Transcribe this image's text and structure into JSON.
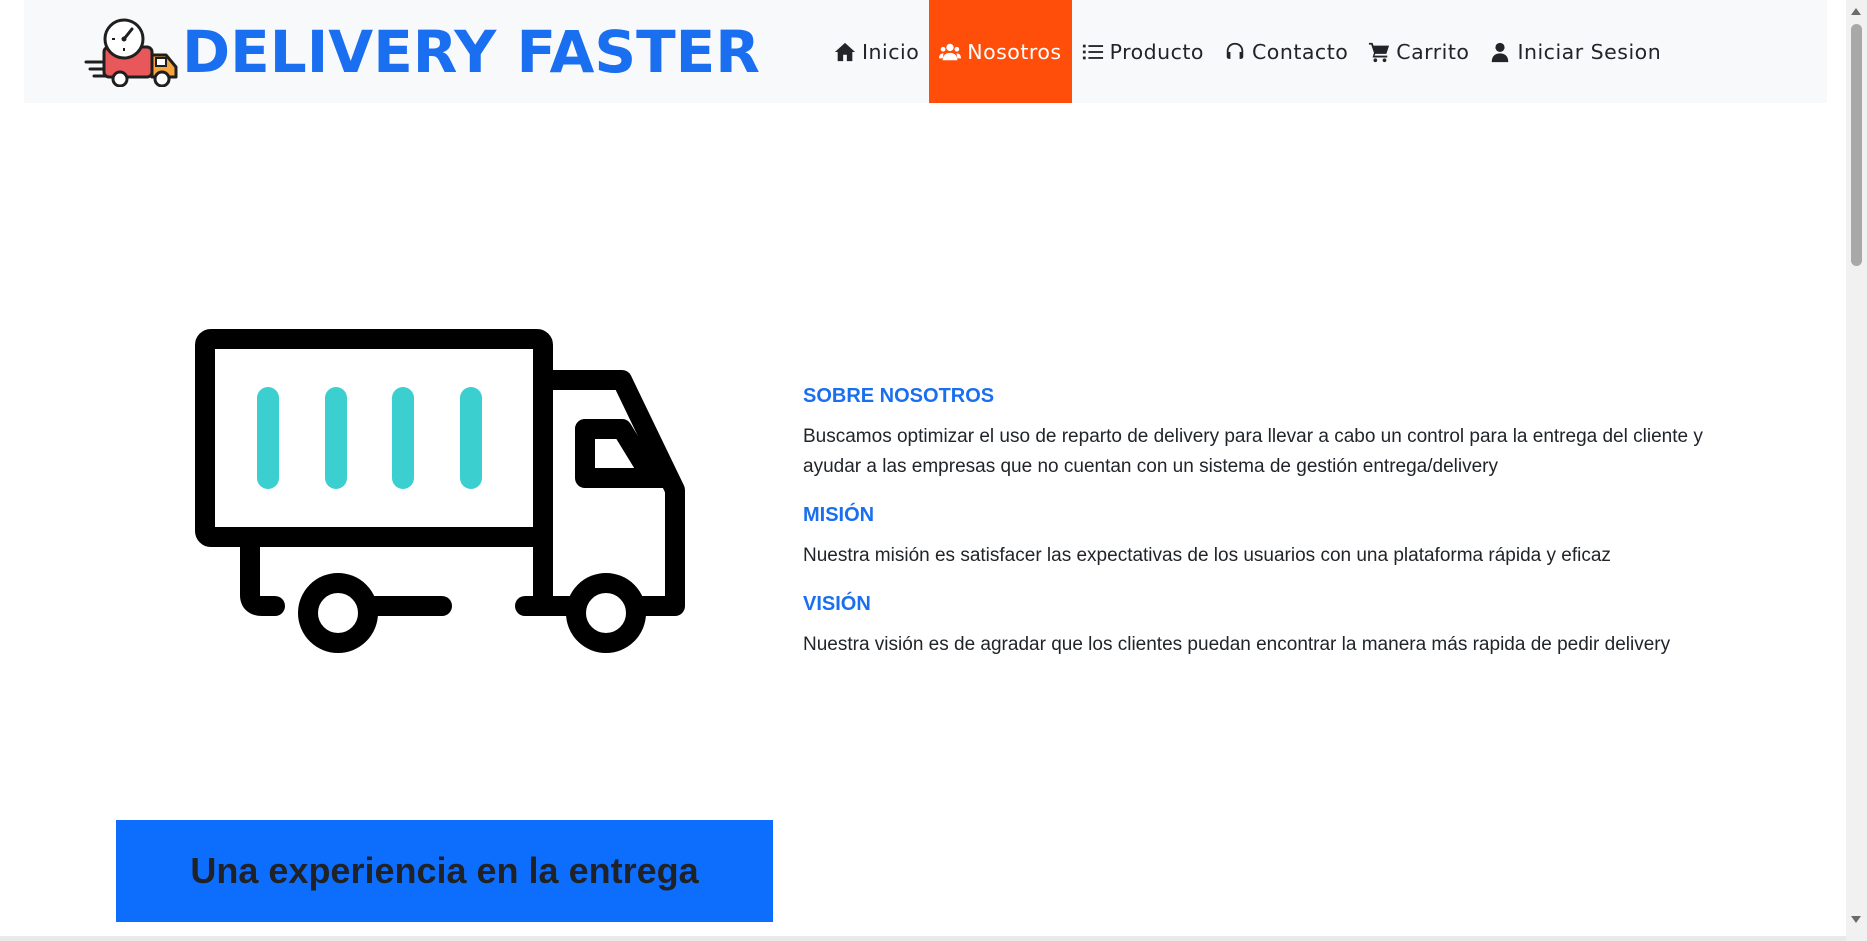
{
  "brand": {
    "name": "DELIVERY FASTER",
    "logo_icon": "delivery-truck-clock-icon"
  },
  "nav": {
    "items": [
      {
        "label": "Inicio",
        "icon": "home-icon",
        "active": false
      },
      {
        "label": "Nosotros",
        "icon": "users-icon",
        "active": true
      },
      {
        "label": "Producto",
        "icon": "list-icon",
        "active": false
      },
      {
        "label": "Contacto",
        "icon": "headset-icon",
        "active": false
      },
      {
        "label": "Carrito",
        "icon": "cart-icon",
        "active": false
      },
      {
        "label": "Iniciar Sesion",
        "icon": "user-icon",
        "active": false
      }
    ],
    "active_color": "#ff4d0a"
  },
  "about": {
    "sections": [
      {
        "title": "SOBRE NOSOTROS",
        "text": "Buscamos optimizar el uso de reparto de delivery para llevar a cabo un control para la entrega del cliente y ayudar a las empresas que no cuentan con un sistema de gestión entrega/delivery"
      },
      {
        "title": "MISIÓN",
        "text": "Nuestra misión es satisfacer las expectativas de los usuarios con una plataforma rápida y eficaz"
      },
      {
        "title": "VISIÓN",
        "text": "Nuestra visión es de agradar que los clientes puedan encontrar la manera más rapida de pedir delivery"
      }
    ],
    "illustration": "truck-icon"
  },
  "banner": {
    "text": "Una experiencia en la entrega",
    "color": "#0d6efd"
  },
  "colors": {
    "brand": "#1a6ff0",
    "title": "#1a6ff0",
    "truck_stripes": "#3bcfcf"
  }
}
